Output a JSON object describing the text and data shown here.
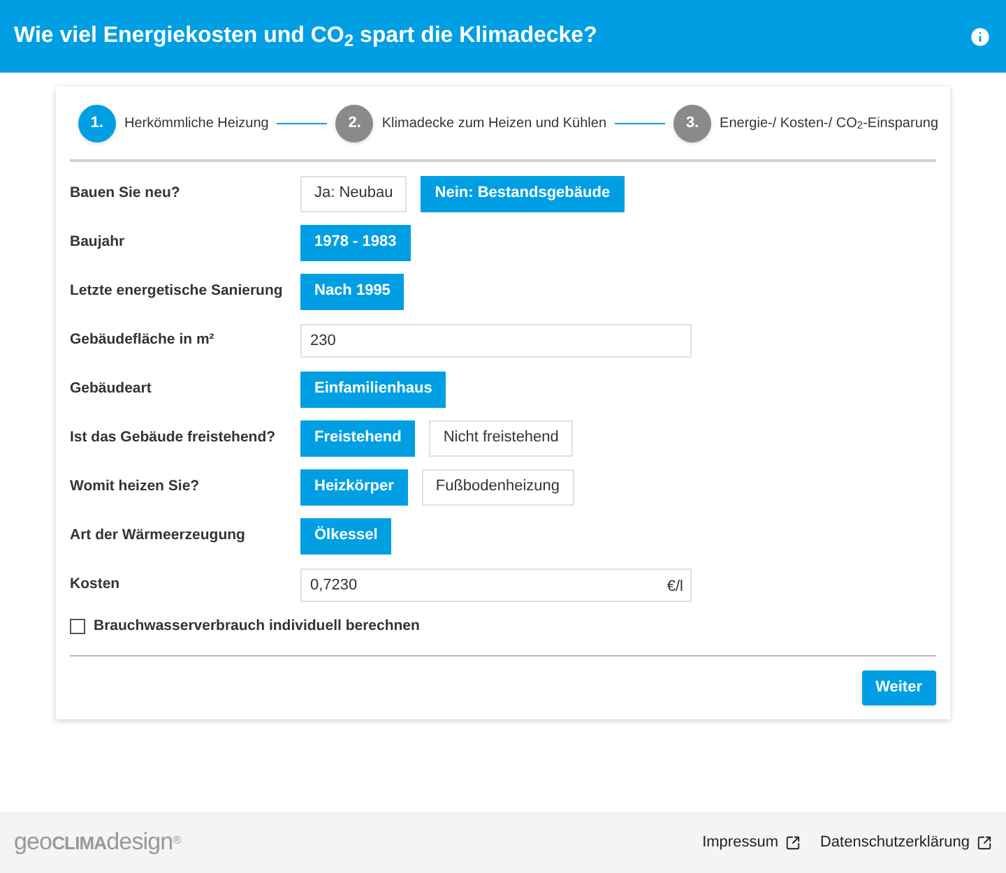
{
  "header": {
    "title": "Wie viel Energiekosten und CO$_{2}$ spart die Klimadecke?"
  },
  "steps": [
    {
      "number": "1.",
      "label": "Herkömmliche Heizung",
      "selected": true
    },
    {
      "number": "2.",
      "label": "Klimadecke zum Heizen und Kühlen",
      "selected": false
    },
    {
      "number": "3.",
      "label": "Energie-/ Kosten-/ CO$_{2}$-Einsparung",
      "selected": false
    }
  ],
  "fields": [
    {
      "kind": "choice",
      "label": "Bauen Sie neu?",
      "options": [
        {
          "label": "Ja: Neubau",
          "selected": false
        },
        {
          "label": "Nein: Bestandsgebäude",
          "selected": true
        }
      ]
    },
    {
      "kind": "choice",
      "label": "Baujahr",
      "options": [
        {
          "label": "1978 - 1983",
          "selected": true
        }
      ]
    },
    {
      "kind": "choice",
      "label": "Letzte energetische Sanierung",
      "options": [
        {
          "label": "Nach 1995",
          "selected": true
        }
      ]
    },
    {
      "kind": "input",
      "label": "Gebäudefläche in m²",
      "value": "230"
    },
    {
      "kind": "choice",
      "label": "Gebäudeart",
      "options": [
        {
          "label": "Einfamilienhaus",
          "selected": true
        }
      ]
    },
    {
      "kind": "choice",
      "label": "Ist das Gebäude freistehend?",
      "options": [
        {
          "label": "Freistehend",
          "selected": true
        },
        {
          "label": "Nicht freistehend",
          "selected": false
        }
      ]
    },
    {
      "kind": "choice",
      "label": "Womit heizen Sie?",
      "options": [
        {
          "label": "Heizkörper",
          "selected": true
        },
        {
          "label": "Fußbodenheizung",
          "selected": false
        }
      ]
    },
    {
      "kind": "choice",
      "label": "Art der Wärmeerzeugung",
      "options": [
        {
          "label": "Ölkessel",
          "selected": true
        }
      ]
    },
    {
      "kind": "input",
      "label": "Kosten",
      "value": "0,7230",
      "unit": "€/l"
    }
  ],
  "checkbox": {
    "label": "Brauchwasserverbrauch individuell berechnen",
    "checked": false
  },
  "next_button": "Weiter",
  "footer": {
    "logo": [
      "geo",
      "CLIMA",
      "design",
      "®"
    ],
    "links": [
      "Impressum",
      "Datenschutzerklärung"
    ]
  }
}
